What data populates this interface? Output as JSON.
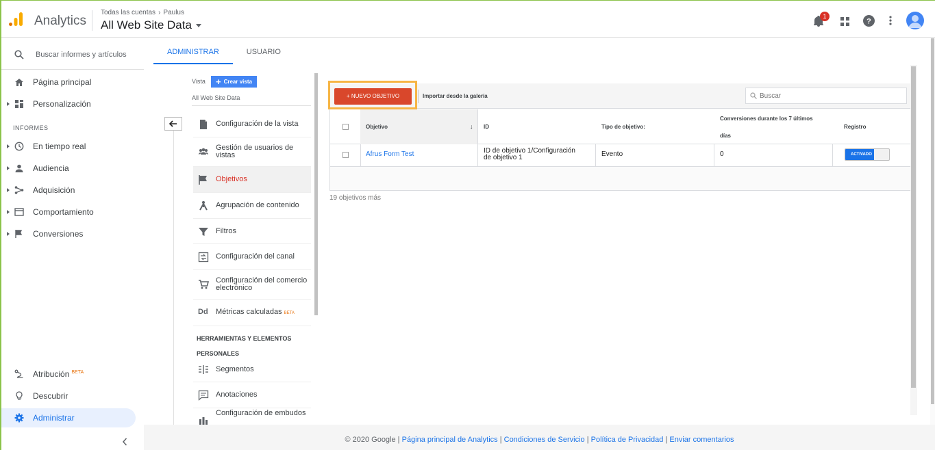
{
  "header": {
    "app_name": "Analytics",
    "breadcrumb_root": "Todas las cuentas",
    "breadcrumb_account": "Paulus",
    "view_name": "All Web Site Data",
    "notification_count": "1"
  },
  "sidebar": {
    "search_placeholder": "Buscar informes y artículos",
    "home": "Página principal",
    "customization": "Personalización",
    "reports_header": "INFORMES",
    "items": [
      {
        "label": "En tiempo real",
        "icon": "clock-icon"
      },
      {
        "label": "Audiencia",
        "icon": "person-icon"
      },
      {
        "label": "Adquisición",
        "icon": "acquisition-icon"
      },
      {
        "label": "Comportamiento",
        "icon": "behavior-icon"
      },
      {
        "label": "Conversiones",
        "icon": "flag-icon"
      }
    ],
    "attribution": "Atribución",
    "attribution_badge": "BETA",
    "discover": "Descubrir",
    "admin": "Administrar"
  },
  "tabs": {
    "admin": "ADMINISTRAR",
    "user": "USUARIO"
  },
  "view_column": {
    "label": "Vista",
    "create_view": "Crear vista",
    "selected_view": "All Web Site Data",
    "menu": [
      "Configuración de la vista",
      "Gestión de usuarios de vistas",
      "Objetivos",
      "Agrupación de contenido",
      "Filtros",
      "Configuración del canal",
      "Configuración del comercio electrónico",
      "Métricas calculadas"
    ],
    "metrics_badge": "BETA",
    "tools_header_1": "HERRAMIENTAS Y ELEMENTOS",
    "tools_header_2": "PERSONALES",
    "tools": [
      "Segmentos",
      "Anotaciones",
      "Configuración de embudos"
    ]
  },
  "goals": {
    "new_goal": "+ NUEVO OBJETIVO",
    "import_gallery": "Importar desde la galería",
    "search_placeholder": "Buscar",
    "columns": {
      "goal": "Objetivo",
      "id": "ID",
      "type": "Tipo de objetivo:",
      "conversions_1": "Conversiones durante los 7 últimos",
      "conversions_2": "días",
      "recording": "Registro"
    },
    "rows": [
      {
        "name": "Afrus Form Test",
        "id_1": "ID de objetivo 1/Configuración",
        "id_2": "de objetivo 1",
        "type": "Evento",
        "conversions": "0",
        "status": "ACTIVADO"
      }
    ],
    "more_goals": "19 objetivos más"
  },
  "footer": {
    "copyright": "© 2020 Google",
    "links": [
      "Página principal de Analytics",
      "Condiciones de Servicio",
      "Política de Privacidad",
      "Enviar comentarios"
    ]
  },
  "colors": {
    "accent": "#1a73e8",
    "new_goal_button": "#d9472b",
    "highlight": "#f6b545",
    "logo_orange": "#f9ab00",
    "logo_dark_orange": "#e37400"
  }
}
